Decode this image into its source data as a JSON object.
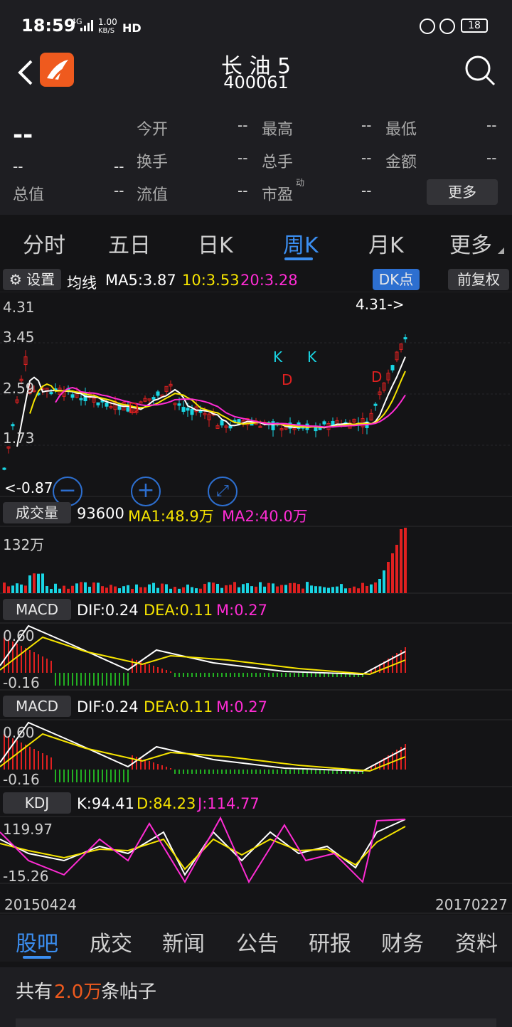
{
  "status_bar": {
    "time": "18:59",
    "net": "4G",
    "speed": "1.00",
    "speed_unit": "KB/S",
    "hd": "HD",
    "battery": "18",
    "icons": [
      "lock-icon",
      "alarm-icon",
      "battery-icon"
    ]
  },
  "header": {
    "name": "长 油 5",
    "code": "400061",
    "logo": "app-logo",
    "search_icon": "search-icon"
  },
  "quote": {
    "price": "--",
    "change": "--",
    "change_pct": "--",
    "fields": [
      {
        "label": "今开",
        "value": "--"
      },
      {
        "label": "最高",
        "value": "--"
      },
      {
        "label": "最低",
        "value": "--"
      },
      {
        "label": "换手",
        "value": "--"
      },
      {
        "label": "总手",
        "value": "--"
      },
      {
        "label": "金额",
        "value": "--"
      },
      {
        "label": "总值",
        "value": "--"
      },
      {
        "label": "流值",
        "value": "--"
      },
      {
        "label": "市盈",
        "value": "--",
        "sup": "动"
      }
    ],
    "more_button": "更多"
  },
  "tabs": [
    "分时",
    "五日",
    "日K",
    "周K",
    "月K",
    "更多"
  ],
  "active_tab": "周K",
  "ma_bar": {
    "settings": "设置",
    "title": "均线",
    "ma5": "MA5:3.87",
    "ma10": "10:3.53",
    "ma20": "20:3.28",
    "dk": "DK点",
    "fq": "前复权"
  },
  "kline": {
    "ticks": [
      "4.31",
      "3.45",
      "2.59",
      "1.73"
    ],
    "high_marker": "4.31->",
    "low_marker": "<-0.87",
    "markers": [
      "D",
      "K",
      "D",
      "K",
      "D",
      "D"
    ]
  },
  "zoom_icons": [
    "zoom-out-icon",
    "zoom-in-icon",
    "fullscreen-icon"
  ],
  "volume": {
    "label": "成交量",
    "value": "93600",
    "ma1": "MA1:48.9万",
    "ma2": "MA2:40.0万",
    "max": "132万"
  },
  "macd1": {
    "label": "MACD",
    "dif": "DIF:0.24",
    "dea": "DEA:0.11",
    "m": "M:0.27",
    "top": "0.60",
    "bottom": "-0.16"
  },
  "macd2": {
    "label": "MACD",
    "dif": "DIF:0.24",
    "dea": "DEA:0.11",
    "m": "M:0.27",
    "top": "0.60",
    "bottom": "-0.16"
  },
  "kdj": {
    "label": "KDJ",
    "k": "K:94.41",
    "d": "D:84.23",
    "j": "J:114.77",
    "top": "119.97",
    "bottom": "-15.26"
  },
  "dates": {
    "start": "20150424",
    "end": "20170227"
  },
  "bottom_tabs": [
    "股吧",
    "成交",
    "新闻",
    "公告",
    "研报",
    "财务",
    "资料"
  ],
  "active_bottom": "股吧",
  "posts": {
    "prefix": "共有",
    "count": "2.0万",
    "suffix": "条帖子"
  },
  "colors": {
    "up": "#e02020",
    "down": "#19d5e3",
    "accent": "#3b8ef0",
    "ma5": "#ffffff",
    "ma10": "#f6e400",
    "ma20": "#ff2cd4",
    "macd_neg": "#22b022"
  }
}
